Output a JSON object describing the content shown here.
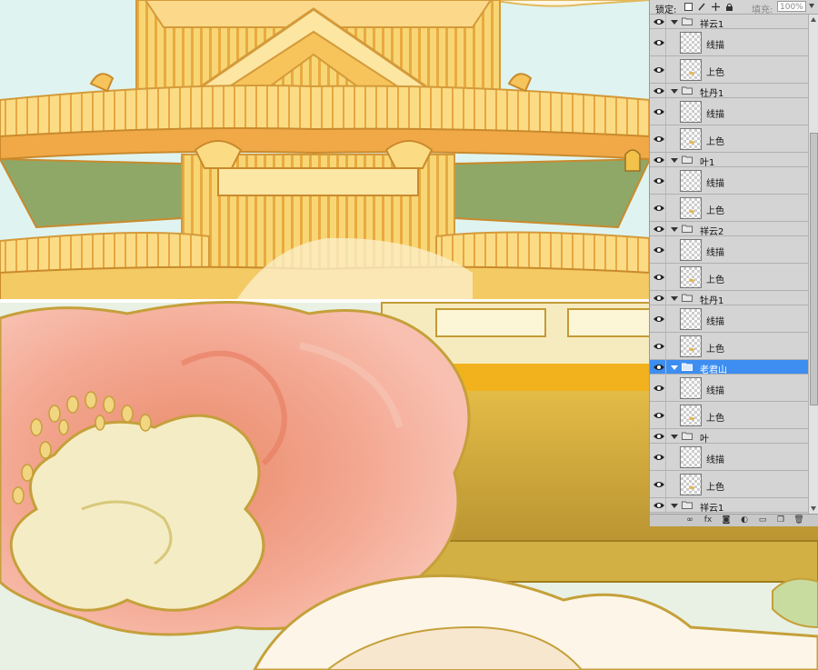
{
  "layers_panel": {
    "lock_label": "锁定:",
    "fill_label": "填充:",
    "fill_value": "100%",
    "rows": [
      {
        "type": "group",
        "name": "祥云1",
        "visible": true,
        "expanded": true,
        "selected": false
      },
      {
        "type": "layer",
        "name": "线描",
        "visible": true,
        "selected": false
      },
      {
        "type": "layer",
        "name": "上色",
        "visible": true,
        "selected": false
      },
      {
        "type": "group",
        "name": "牡丹1",
        "visible": true,
        "expanded": true,
        "selected": false
      },
      {
        "type": "layer",
        "name": "线描",
        "visible": true,
        "selected": false
      },
      {
        "type": "layer",
        "name": "上色",
        "visible": true,
        "selected": false
      },
      {
        "type": "group",
        "name": "叶1",
        "visible": true,
        "expanded": true,
        "selected": false
      },
      {
        "type": "layer",
        "name": "线描",
        "visible": true,
        "selected": false
      },
      {
        "type": "layer",
        "name": "上色",
        "visible": true,
        "selected": false
      },
      {
        "type": "group",
        "name": "祥云2",
        "visible": true,
        "expanded": true,
        "selected": false
      },
      {
        "type": "layer",
        "name": "线描",
        "visible": true,
        "selected": false
      },
      {
        "type": "layer",
        "name": "上色",
        "visible": true,
        "selected": false
      },
      {
        "type": "group",
        "name": "牡丹1",
        "visible": true,
        "expanded": true,
        "selected": false
      },
      {
        "type": "layer",
        "name": "线描",
        "visible": true,
        "selected": false
      },
      {
        "type": "layer",
        "name": "上色",
        "visible": true,
        "selected": false
      },
      {
        "type": "group",
        "name": "老君山",
        "visible": true,
        "expanded": true,
        "selected": true
      },
      {
        "type": "layer",
        "name": "线描",
        "visible": true,
        "selected": false
      },
      {
        "type": "layer",
        "name": "上色",
        "visible": true,
        "selected": false
      },
      {
        "type": "group",
        "name": "叶",
        "visible": true,
        "expanded": true,
        "selected": false
      },
      {
        "type": "layer",
        "name": "线描",
        "visible": true,
        "selected": false
      },
      {
        "type": "layer",
        "name": "上色",
        "visible": true,
        "selected": false
      },
      {
        "type": "group",
        "name": "祥云1",
        "visible": true,
        "expanded": true,
        "selected": false
      }
    ],
    "bottom_icons": [
      "link-layers-icon",
      "fx-icon",
      "mask-icon",
      "adjustment-icon",
      "new-group-icon",
      "new-layer-icon",
      "trash-icon"
    ],
    "bottom_glyphs": [
      "∞",
      "fx",
      "◙",
      "◐",
      "▭",
      "❐",
      "🗑"
    ]
  },
  "colors": {
    "panel_bg": "#d4d4d4",
    "selection": "#3d8ef0",
    "gold": "#f2c24a",
    "peony_pink": "#f4a38e",
    "peony_cream": "#f4ecc4",
    "sky": "#dff3ef"
  }
}
